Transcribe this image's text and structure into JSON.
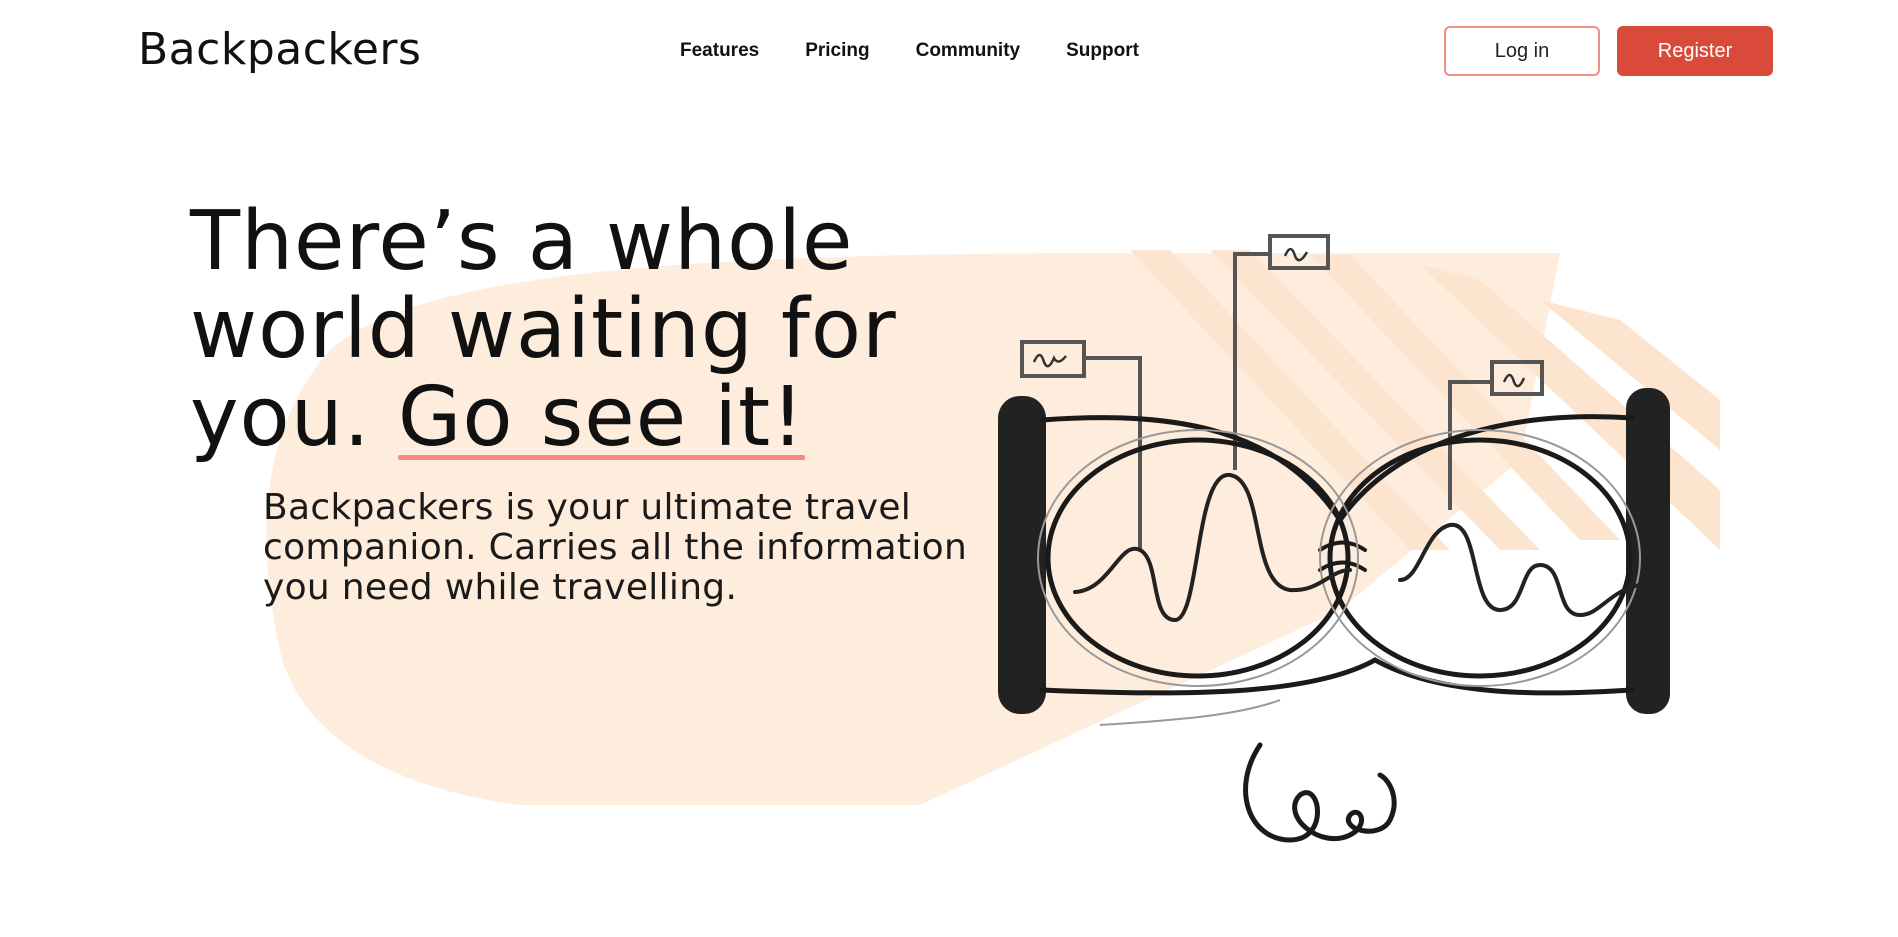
{
  "header": {
    "logo": "Backpackers",
    "nav": [
      "Features",
      "Pricing",
      "Community",
      "Support"
    ],
    "login_label": "Log in",
    "register_label": "Register"
  },
  "hero": {
    "headline_main": "There’s a whole world waiting for you.",
    "headline_accent": "Go see it!",
    "description": "Backpackers is your ultimate travel companion. Carries all the information you need while travelling."
  },
  "colors": {
    "accent": "#d94a3a",
    "accent_light": "#f08f86",
    "blob": "#feecdd",
    "stripes": "#fde4cf"
  },
  "icons": [
    "binoculars-illustration"
  ]
}
